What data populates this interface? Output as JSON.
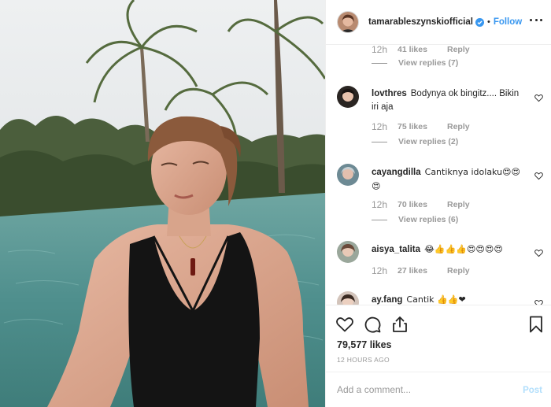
{
  "post": {
    "username": "tamarableszynskiofficial",
    "verified_icon": "verified-badge-icon",
    "separator": "•",
    "follow_label": "Follow",
    "likes": "79,577 likes",
    "time_ago": "12 HOURS AGO"
  },
  "comments": [
    {
      "id": "partial",
      "time": "12h",
      "likes": "41 likes",
      "reply": "Reply",
      "view_replies": "View replies (7)"
    },
    {
      "id": "lovthres",
      "username": "lovthres",
      "text": "Bodynya ok bingitz.... Bikin iri aja",
      "time": "12h",
      "likes": "75 likes",
      "reply": "Reply",
      "view_replies": "View replies (2)"
    },
    {
      "id": "cayangdilla",
      "username": "cayangdilla",
      "text": "Cantiknya idolaku😍😍😍",
      "time": "12h",
      "likes": "70 likes",
      "reply": "Reply",
      "view_replies": "View replies (6)"
    },
    {
      "id": "aisya_talita",
      "username": "aisya_talita",
      "text": "😂👍👍👍😍😍😍😍",
      "time": "12h",
      "likes": "27 likes",
      "reply": "Reply"
    },
    {
      "id": "ayfang",
      "username": "ay.fang",
      "text": "Cantik 👍👍❤"
    }
  ],
  "add_comment": {
    "placeholder": "Add a comment...",
    "post_label": "Post"
  },
  "colors": {
    "accent": "#3897f0",
    "muted": "#999999",
    "text": "#262626",
    "post_disabled": "#b2dffc"
  }
}
